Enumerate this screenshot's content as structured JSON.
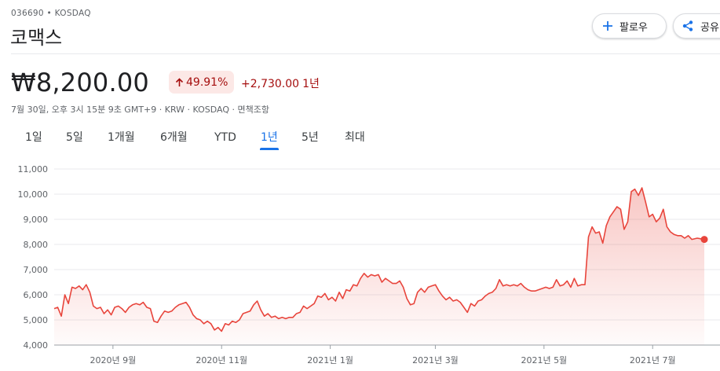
{
  "header": {
    "ticker": "036690 • KOSDAQ",
    "name": "코맥스",
    "follow_label": "팔로우",
    "share_label": "공유"
  },
  "quote": {
    "price": "₩8,200.00",
    "change_percent": "49.91%",
    "change_abs": "+2,730.00",
    "change_period": "1년",
    "meta": "7월 30일, 오후 3시 15분 9초 GMT+9 · KRW · KOSDAQ · 면책조항",
    "colors": {
      "down_red": "#a50e0e",
      "chip_bg": "#fce8e6",
      "line": "#e8453c",
      "accent": "#1a73e8"
    }
  },
  "icons": {
    "follow": "plus-icon",
    "share": "share-icon",
    "change": "arrow-up-icon"
  },
  "tabs": [
    {
      "label": "1일",
      "active": false
    },
    {
      "label": "5일",
      "active": false
    },
    {
      "label": "1개월",
      "active": false
    },
    {
      "label": "6개월",
      "active": false
    },
    {
      "label": "YTD",
      "active": false
    },
    {
      "label": "1년",
      "active": true
    },
    {
      "label": "5년",
      "active": false
    },
    {
      "label": "최대",
      "active": false
    }
  ],
  "chart_data": {
    "type": "area",
    "title": "",
    "xlabel": "",
    "ylabel": "",
    "ylim": [
      4000,
      11000
    ],
    "y_ticks": [
      4000,
      5000,
      6000,
      7000,
      8000,
      9000,
      10000,
      11000
    ],
    "y_tick_labels": [
      "4,000",
      "5,000",
      "6,000",
      "7,000",
      "8,000",
      "9,000",
      "10,000",
      "11,000"
    ],
    "x_range": [
      "2020-07-30",
      "2021-07-30"
    ],
    "x_ticks": [
      {
        "date": "2020-09-01",
        "label": "2020년 9월"
      },
      {
        "date": "2020-11-01",
        "label": "2020년 11월"
      },
      {
        "date": "2021-01-01",
        "label": "2021년 1월"
      },
      {
        "date": "2021-03-01",
        "label": "2021년 3월"
      },
      {
        "date": "2021-05-01",
        "label": "2021년 5월"
      },
      {
        "date": "2021-07-01",
        "label": "2021년 7월"
      }
    ],
    "grid": "horizontal",
    "series": [
      {
        "points": [
          [
            "2020-07-30",
            5450
          ],
          [
            "2020-08-01",
            5500
          ],
          [
            "2020-08-03",
            5150
          ],
          [
            "2020-08-05",
            6000
          ],
          [
            "2020-08-07",
            5650
          ],
          [
            "2020-08-09",
            6300
          ],
          [
            "2020-08-11",
            6250
          ],
          [
            "2020-08-13",
            6350
          ],
          [
            "2020-08-15",
            6200
          ],
          [
            "2020-08-17",
            6400
          ],
          [
            "2020-08-19",
            6100
          ],
          [
            "2020-08-21",
            5550
          ],
          [
            "2020-08-23",
            5450
          ],
          [
            "2020-08-25",
            5500
          ],
          [
            "2020-08-27",
            5250
          ],
          [
            "2020-08-29",
            5400
          ],
          [
            "2020-08-31",
            5200
          ],
          [
            "2020-09-02",
            5500
          ],
          [
            "2020-09-04",
            5550
          ],
          [
            "2020-09-06",
            5450
          ],
          [
            "2020-09-08",
            5300
          ],
          [
            "2020-09-10",
            5500
          ],
          [
            "2020-09-12",
            5600
          ],
          [
            "2020-09-14",
            5650
          ],
          [
            "2020-09-16",
            5600
          ],
          [
            "2020-09-18",
            5700
          ],
          [
            "2020-09-20",
            5500
          ],
          [
            "2020-09-22",
            5450
          ],
          [
            "2020-09-24",
            4950
          ],
          [
            "2020-09-26",
            4900
          ],
          [
            "2020-09-28",
            5150
          ],
          [
            "2020-09-30",
            5350
          ],
          [
            "2020-10-02",
            5300
          ],
          [
            "2020-10-04",
            5350
          ],
          [
            "2020-10-06",
            5500
          ],
          [
            "2020-10-08",
            5600
          ],
          [
            "2020-10-10",
            5650
          ],
          [
            "2020-10-12",
            5700
          ],
          [
            "2020-10-14",
            5500
          ],
          [
            "2020-10-16",
            5200
          ],
          [
            "2020-10-18",
            5050
          ],
          [
            "2020-10-20",
            5000
          ],
          [
            "2020-10-22",
            4850
          ],
          [
            "2020-10-24",
            4950
          ],
          [
            "2020-10-26",
            4850
          ],
          [
            "2020-10-28",
            4600
          ],
          [
            "2020-10-30",
            4700
          ],
          [
            "2020-11-01",
            4550
          ],
          [
            "2020-11-03",
            4850
          ],
          [
            "2020-11-05",
            4800
          ],
          [
            "2020-11-07",
            4950
          ],
          [
            "2020-11-09",
            4900
          ],
          [
            "2020-11-11",
            5000
          ],
          [
            "2020-11-13",
            5250
          ],
          [
            "2020-11-15",
            5300
          ],
          [
            "2020-11-17",
            5350
          ],
          [
            "2020-11-19",
            5600
          ],
          [
            "2020-11-21",
            5750
          ],
          [
            "2020-11-23",
            5400
          ],
          [
            "2020-11-25",
            5150
          ],
          [
            "2020-11-27",
            5250
          ],
          [
            "2020-11-29",
            5100
          ],
          [
            "2020-12-01",
            5150
          ],
          [
            "2020-12-03",
            5050
          ],
          [
            "2020-12-05",
            5100
          ],
          [
            "2020-12-07",
            5050
          ],
          [
            "2020-12-09",
            5100
          ],
          [
            "2020-12-11",
            5100
          ],
          [
            "2020-12-13",
            5250
          ],
          [
            "2020-12-15",
            5300
          ],
          [
            "2020-12-17",
            5550
          ],
          [
            "2020-12-19",
            5450
          ],
          [
            "2020-12-21",
            5550
          ],
          [
            "2020-12-23",
            5650
          ],
          [
            "2020-12-25",
            5950
          ],
          [
            "2020-12-27",
            5900
          ],
          [
            "2020-12-29",
            6050
          ],
          [
            "2020-12-31",
            5800
          ],
          [
            "2021-01-02",
            5900
          ],
          [
            "2021-01-04",
            5750
          ],
          [
            "2021-01-06",
            6100
          ],
          [
            "2021-01-08",
            5850
          ],
          [
            "2021-01-10",
            6200
          ],
          [
            "2021-01-12",
            6150
          ],
          [
            "2021-01-14",
            6400
          ],
          [
            "2021-01-16",
            6350
          ],
          [
            "2021-01-18",
            6650
          ],
          [
            "2021-01-20",
            6850
          ],
          [
            "2021-01-22",
            6700
          ],
          [
            "2021-01-24",
            6800
          ],
          [
            "2021-01-26",
            6750
          ],
          [
            "2021-01-28",
            6800
          ],
          [
            "2021-01-30",
            6500
          ],
          [
            "2021-02-01",
            6650
          ],
          [
            "2021-02-03",
            6550
          ],
          [
            "2021-02-05",
            6450
          ],
          [
            "2021-02-07",
            6450
          ],
          [
            "2021-02-09",
            6550
          ],
          [
            "2021-02-11",
            6300
          ],
          [
            "2021-02-13",
            5850
          ],
          [
            "2021-02-15",
            5600
          ],
          [
            "2021-02-17",
            5650
          ],
          [
            "2021-02-19",
            6100
          ],
          [
            "2021-02-21",
            6250
          ],
          [
            "2021-02-23",
            6100
          ],
          [
            "2021-02-25",
            6300
          ],
          [
            "2021-02-27",
            6350
          ],
          [
            "2021-03-01",
            6400
          ],
          [
            "2021-03-03",
            6150
          ],
          [
            "2021-03-05",
            5950
          ],
          [
            "2021-03-07",
            5800
          ],
          [
            "2021-03-09",
            5900
          ],
          [
            "2021-03-11",
            5750
          ],
          [
            "2021-03-13",
            5800
          ],
          [
            "2021-03-15",
            5700
          ],
          [
            "2021-03-17",
            5500
          ],
          [
            "2021-03-19",
            5300
          ],
          [
            "2021-03-21",
            5650
          ],
          [
            "2021-03-23",
            5550
          ],
          [
            "2021-03-25",
            5750
          ],
          [
            "2021-03-27",
            5800
          ],
          [
            "2021-03-29",
            5950
          ],
          [
            "2021-03-31",
            6050
          ],
          [
            "2021-04-02",
            6100
          ],
          [
            "2021-04-04",
            6250
          ],
          [
            "2021-04-06",
            6600
          ],
          [
            "2021-04-08",
            6350
          ],
          [
            "2021-04-10",
            6400
          ],
          [
            "2021-04-12",
            6350
          ],
          [
            "2021-04-14",
            6400
          ],
          [
            "2021-04-16",
            6350
          ],
          [
            "2021-04-18",
            6450
          ],
          [
            "2021-04-20",
            6300
          ],
          [
            "2021-04-22",
            6200
          ],
          [
            "2021-04-24",
            6150
          ],
          [
            "2021-04-26",
            6150
          ],
          [
            "2021-04-28",
            6200
          ],
          [
            "2021-04-30",
            6250
          ],
          [
            "2021-05-02",
            6300
          ],
          [
            "2021-05-04",
            6250
          ],
          [
            "2021-05-06",
            6300
          ],
          [
            "2021-05-08",
            6600
          ],
          [
            "2021-05-10",
            6350
          ],
          [
            "2021-05-12",
            6400
          ],
          [
            "2021-05-14",
            6550
          ],
          [
            "2021-05-16",
            6300
          ],
          [
            "2021-05-18",
            6650
          ],
          [
            "2021-05-20",
            6350
          ],
          [
            "2021-05-22",
            6400
          ],
          [
            "2021-05-24",
            6400
          ],
          [
            "2021-05-26",
            8300
          ],
          [
            "2021-05-28",
            8700
          ],
          [
            "2021-05-30",
            8450
          ],
          [
            "2021-06-01",
            8500
          ],
          [
            "2021-06-03",
            8050
          ],
          [
            "2021-06-05",
            8750
          ],
          [
            "2021-06-07",
            9100
          ],
          [
            "2021-06-09",
            9300
          ],
          [
            "2021-06-11",
            9500
          ],
          [
            "2021-06-13",
            9400
          ],
          [
            "2021-06-15",
            8600
          ],
          [
            "2021-06-17",
            8900
          ],
          [
            "2021-06-19",
            10100
          ],
          [
            "2021-06-21",
            10200
          ],
          [
            "2021-06-23",
            9950
          ],
          [
            "2021-06-25",
            10250
          ],
          [
            "2021-06-27",
            9700
          ],
          [
            "2021-06-29",
            9100
          ],
          [
            "2021-07-01",
            9200
          ],
          [
            "2021-07-03",
            8900
          ],
          [
            "2021-07-05",
            9050
          ],
          [
            "2021-07-07",
            9400
          ],
          [
            "2021-07-09",
            8700
          ],
          [
            "2021-07-11",
            8500
          ],
          [
            "2021-07-13",
            8400
          ],
          [
            "2021-07-15",
            8350
          ],
          [
            "2021-07-17",
            8350
          ],
          [
            "2021-07-19",
            8250
          ],
          [
            "2021-07-21",
            8350
          ],
          [
            "2021-07-23",
            8200
          ],
          [
            "2021-07-26",
            8250
          ],
          [
            "2021-07-30",
            8200
          ]
        ]
      }
    ]
  }
}
